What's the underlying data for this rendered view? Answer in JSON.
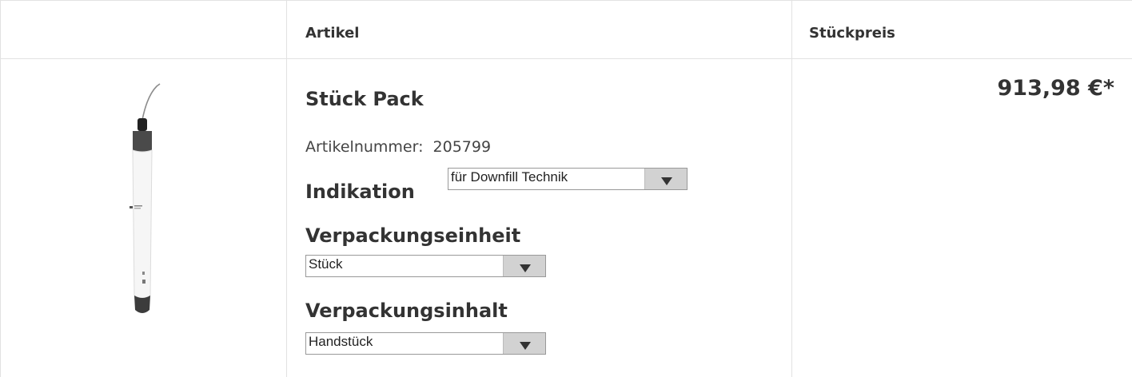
{
  "header": {
    "image_col": "",
    "article_col": "Artikel",
    "price_col": "Stückpreis"
  },
  "product": {
    "name": "Stück Pack",
    "article_number_label": "Artikelnummer:",
    "article_number": "205799",
    "image_icon": "dental-handpiece-image",
    "options": {
      "indikation": {
        "label": "Indikation",
        "value": "für Downfill Technik"
      },
      "verpackungseinheit": {
        "label": "Verpackungseinheit",
        "value": "Stück"
      },
      "verpackungsinhalt": {
        "label": "Verpackungsinhalt",
        "value": "Handstück"
      }
    },
    "price": "913,98 €*"
  }
}
